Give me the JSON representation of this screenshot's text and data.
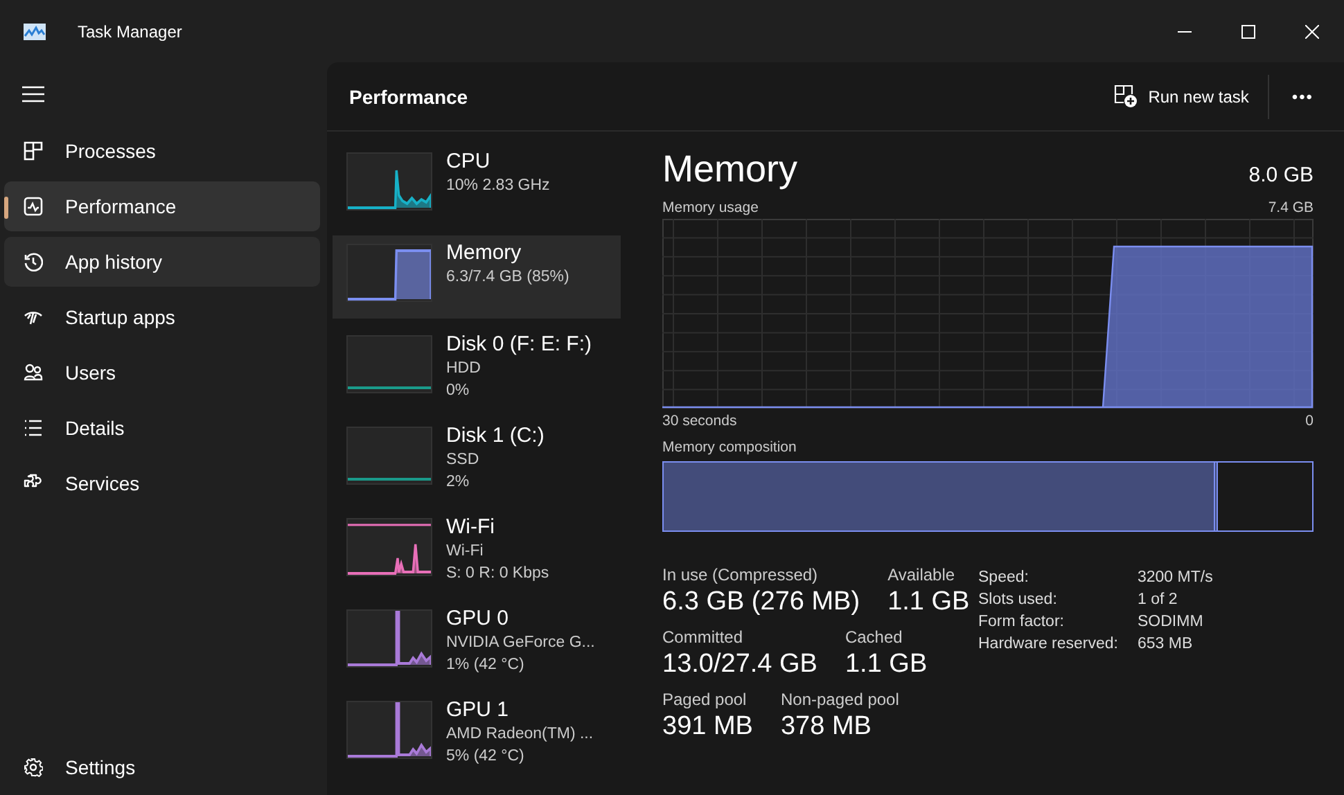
{
  "window": {
    "title": "Task Manager"
  },
  "sidebar": {
    "items": [
      {
        "label": "Processes",
        "selected": false,
        "highlighted": false
      },
      {
        "label": "Performance",
        "selected": true,
        "highlighted": false
      },
      {
        "label": "App history",
        "selected": false,
        "highlighted": true
      },
      {
        "label": "Startup apps",
        "selected": false,
        "highlighted": false
      },
      {
        "label": "Users",
        "selected": false,
        "highlighted": false
      },
      {
        "label": "Details",
        "selected": false,
        "highlighted": false
      },
      {
        "label": "Services",
        "selected": false,
        "highlighted": false
      }
    ],
    "footer": {
      "label": "Settings"
    }
  },
  "header": {
    "title": "Performance",
    "action": "Run new task",
    "more": "•••"
  },
  "devices": [
    {
      "kind": "cpu",
      "name": "CPU",
      "lines": [
        "10%  2.83 GHz"
      ],
      "color": "#17b1c7",
      "selected": false
    },
    {
      "kind": "memory",
      "name": "Memory",
      "lines": [
        "6.3/7.4 GB (85%)"
      ],
      "color": "#7b8ef0",
      "selected": true
    },
    {
      "kind": "disk",
      "name": "Disk 0 (F: E: F:)",
      "lines": [
        "HDD",
        "0%"
      ],
      "color": "#1a9a8a",
      "selected": false
    },
    {
      "kind": "disk",
      "name": "Disk 1 (C:)",
      "lines": [
        "SSD",
        "2%"
      ],
      "color": "#1a9a8a",
      "selected": false
    },
    {
      "kind": "network",
      "name": "Wi-Fi",
      "lines": [
        "Wi-Fi",
        "S: 0 R: 0 Kbps"
      ],
      "color": "#e86fb8",
      "selected": false
    },
    {
      "kind": "gpu",
      "name": "GPU 0",
      "lines": [
        "NVIDIA GeForce G...",
        "1%  (42 °C)"
      ],
      "color": "#a97ad8",
      "selected": false
    },
    {
      "kind": "gpu",
      "name": "GPU 1",
      "lines": [
        "AMD Radeon(TM) ...",
        "5%  (42 °C)"
      ],
      "color": "#a97ad8",
      "selected": false
    }
  ],
  "detail": {
    "title": "Memory",
    "total": "8.0 GB",
    "usage_chart": {
      "label": "Memory usage",
      "max": "7.4 GB",
      "span": "30 seconds",
      "min": "0"
    },
    "composition": {
      "label": "Memory composition",
      "level": 0.855
    },
    "stats": [
      [
        {
          "label": "In use (Compressed)",
          "value": "6.3 GB (276 MB)"
        },
        {
          "label": "Available",
          "value": "1.1 GB"
        }
      ],
      [
        {
          "label": "Committed",
          "value": "13.0/27.4 GB"
        },
        {
          "label": "Cached",
          "value": "1.1 GB"
        }
      ],
      [
        {
          "label": "Paged pool",
          "value": "391 MB"
        },
        {
          "label": "Non-paged pool",
          "value": "378 MB"
        }
      ]
    ],
    "properties": [
      {
        "label": "Speed:",
        "value": "3200 MT/s"
      },
      {
        "label": "Slots used:",
        "value": "1 of 2"
      },
      {
        "label": "Form factor:",
        "value": "SODIMM"
      },
      {
        "label": "Hardware reserved:",
        "value": "653 MB"
      }
    ]
  }
}
